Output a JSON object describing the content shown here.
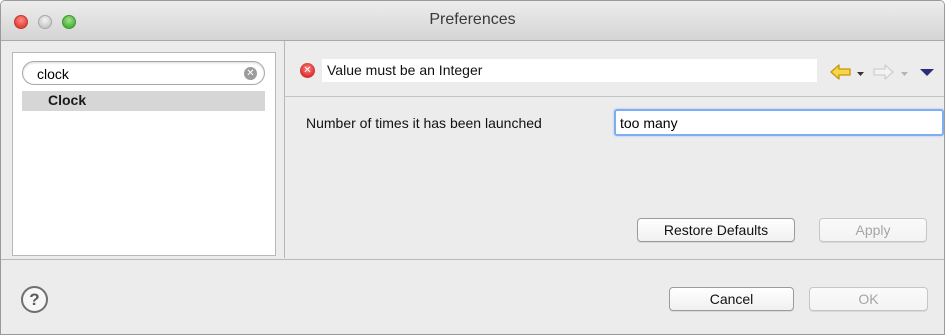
{
  "window": {
    "title": "Preferences"
  },
  "filter": {
    "value": "clock",
    "clear_icon": "clear-search-icon"
  },
  "tree": {
    "items": [
      {
        "label": "Clock",
        "selected": true
      }
    ]
  },
  "message": {
    "text": "Value must be an Integer",
    "icon": "error-icon",
    "icon_color": "#d42626"
  },
  "navigation": {
    "back_icon": "back-arrow-icon",
    "back_color": "#e9b000",
    "forward_icon": "forward-arrow-icon",
    "view_menu_icon": "view-menu-icon"
  },
  "page": {
    "field_label": "Number of times it has been launched",
    "field_value": "too many"
  },
  "buttons": {
    "restore_defaults": "Restore Defaults",
    "apply": "Apply",
    "cancel": "Cancel",
    "ok": "OK"
  },
  "help": {
    "label": "?"
  }
}
